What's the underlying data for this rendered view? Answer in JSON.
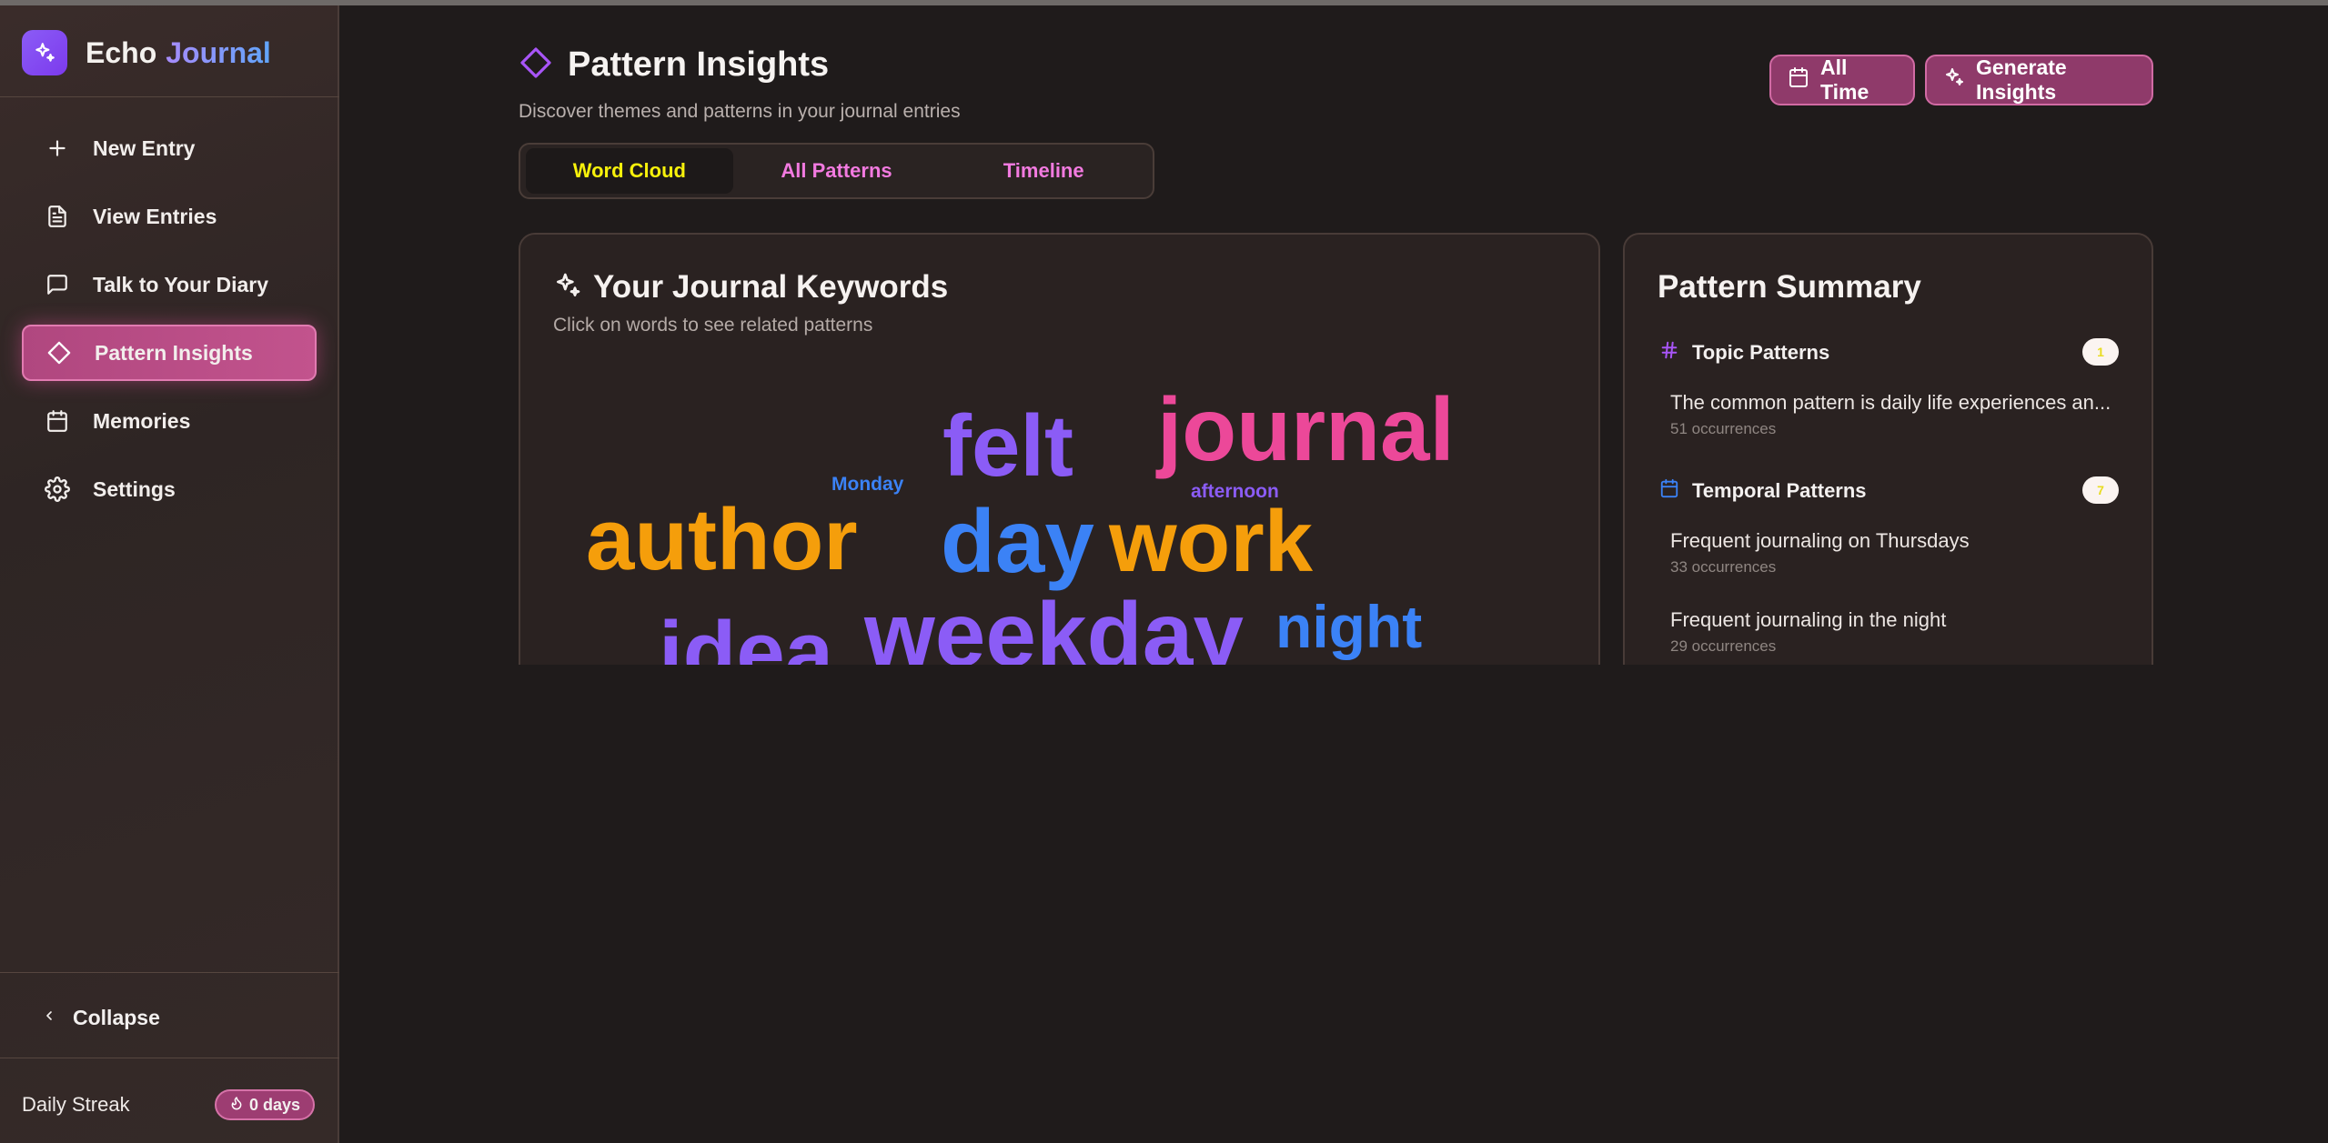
{
  "app": {
    "name_a": "Echo",
    "name_b": "Journal"
  },
  "nav": [
    {
      "label": "New Entry",
      "icon": "plus-icon"
    },
    {
      "label": "View Entries",
      "icon": "file-text-icon"
    },
    {
      "label": "Talk to Your Diary",
      "icon": "message-square-icon"
    },
    {
      "label": "Pattern Insights",
      "icon": "diamond-icon",
      "active": true
    },
    {
      "label": "Memories",
      "icon": "calendar-icon"
    },
    {
      "label": "Settings",
      "icon": "gear-icon"
    }
  ],
  "sidebar_footer": {
    "collapse": "Collapse",
    "streak_label": "Daily Streak",
    "streak_value": "0 days"
  },
  "page": {
    "title": "Pattern Insights",
    "subtitle": "Discover themes and patterns in your journal entries"
  },
  "tabs": [
    {
      "label": "Word Cloud",
      "active": true
    },
    {
      "label": "All Patterns",
      "active": false
    },
    {
      "label": "Timeline",
      "active": false
    }
  ],
  "header_buttons": {
    "all_time": "All Time",
    "generate": "Generate Insights"
  },
  "word_cloud": {
    "title": "Your Journal Keywords",
    "subtitle": "Click on words to see related patterns",
    "words": [
      {
        "text": "journal",
        "color": "#ec4899"
      },
      {
        "text": "felt",
        "color": "#8b5cf6"
      },
      {
        "text": "Monday",
        "color": "#3b82f6"
      },
      {
        "text": "afternoon",
        "color": "#8b5cf6"
      },
      {
        "text": "author",
        "color": "#f59e0b"
      },
      {
        "text": "day",
        "color": "#3b82f6"
      },
      {
        "text": "work",
        "color": "#f59e0b"
      },
      {
        "text": "idea",
        "color": "#8b5cf6"
      },
      {
        "text": "weekday",
        "color": "#8b5cf6"
      },
      {
        "text": "night",
        "color": "#3b82f6"
      }
    ]
  },
  "summary": {
    "title": "Pattern Summary",
    "sections": [
      {
        "label": "Topic Patterns",
        "icon": "hash-icon",
        "count": "1",
        "items": [
          {
            "text": "The common pattern is daily life experiences an...",
            "count": "51 occurrences"
          }
        ]
      },
      {
        "label": "Temporal Patterns",
        "icon": "calendar-icon",
        "count": "7",
        "items": [
          {
            "text": "Frequent journaling on Thursdays",
            "count": "33 occurrences"
          },
          {
            "text": "Frequent journaling in the night",
            "count": "29 occurrences"
          }
        ]
      }
    ]
  },
  "colors": {
    "accent_pink": "#c2538d",
    "accent_purple": "#8b5cf6",
    "active_tab_text": "#f7f10b",
    "tab_text": "#f27ae0",
    "background": "#1f1b1b"
  }
}
